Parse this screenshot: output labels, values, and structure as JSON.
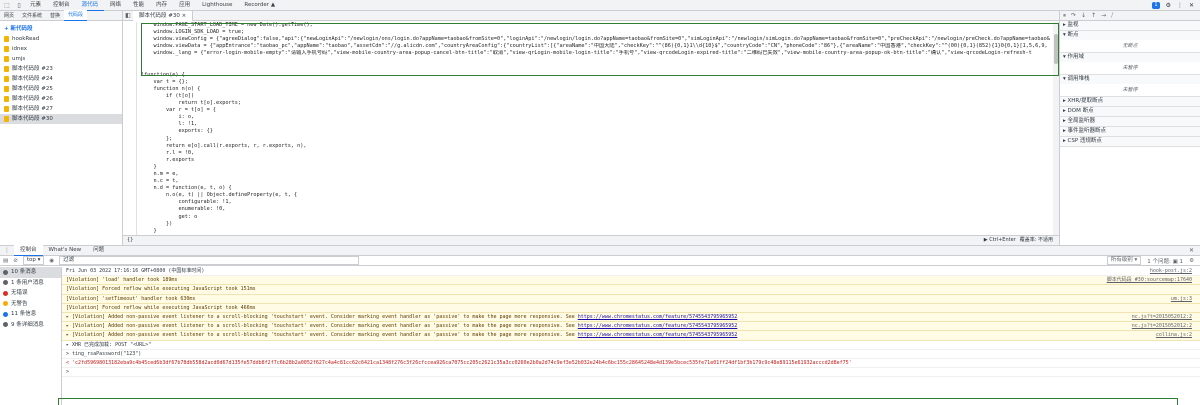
{
  "topbar": {
    "tabs": [
      {
        "label": "元素",
        "active": false
      },
      {
        "label": "控制台",
        "active": false
      },
      {
        "label": "源代码",
        "active": true
      },
      {
        "label": "网络",
        "active": false
      },
      {
        "label": "性能",
        "active": false
      },
      {
        "label": "内存",
        "active": false
      },
      {
        "label": "应用",
        "active": false
      },
      {
        "label": "Lighthouse",
        "active": false
      },
      {
        "label": "Recorder ▲",
        "active": false
      }
    ],
    "badge": "1"
  },
  "nav": {
    "tabs": [
      {
        "label": "网页",
        "active": false
      },
      {
        "label": "文件系统",
        "active": false
      },
      {
        "label": "替换",
        "active": false
      },
      {
        "label": "代码段",
        "active": true
      }
    ],
    "new_snippet": "+ 新代码段",
    "items": [
      {
        "label": "hookRead",
        "selected": false
      },
      {
        "label": "idnex",
        "selected": false
      },
      {
        "label": "umjs",
        "selected": false
      },
      {
        "label": "脚本代码段 #23",
        "selected": false
      },
      {
        "label": "脚本代码段 #24",
        "selected": false
      },
      {
        "label": "脚本代码段 #25",
        "selected": false
      },
      {
        "label": "脚本代码段 #26",
        "selected": false
      },
      {
        "label": "脚本代码段 #27",
        "selected": false
      },
      {
        "label": "脚本代码段 #30",
        "selected": true
      }
    ]
  },
  "editor": {
    "tab_label": "脚本代码段 #30 ×",
    "code_lines": [
      "    window.PAGE_START_LOAD_TIME = new Date().getTime();",
      "    window.LOGIN_SDK_LOAD = true;",
      "    window.viewConfig = {\"agreeDialog\":false,\"api\":{\"newLoginApi\":\"/newlogin/ons/login.do?appName=taobao&fromSite=0\",\"loginApi\":\"/newlogin/login.do?appName=taobao&fromSite=0\",\"simLoginApi\":\"/newlogin/simLogin.do?appName=taobao&fromSite=0\",\"preCheckApi\":\"/newlogin/preCheck.do?appName=taobao&",
      "    window.viewData = {\"appEntrance\":\"taobao_pc\",\"appName\":\"taobao\",\"assetCdn\":\"//g.alicdn.com\",\"countryAreaConfig\":{\"countryList\":[{\"areaName\":\"中国大陆\",\"checkKey\":\"^(86){0,1}1\\\\d{10}$\",\"countryCode\":\"CN\",\"phoneCode\":\"86\"},{\"areaName\":\"中国香港\",\"checkKey\":\"^(00){0,1}(852){1}0{0,1}[1,5,6,9,",
      "    window._lang = {\"error-login-mobile-empty\":\"请输入手机号码\",\"view-mobile-country-area-popup-cancel-btn-title\":\"取消\",\"view-qrLogin-mobile-login-title\":\"手机号\",\"view-qrcodeLogin-expired-title\":\"二维码已失效\",\"view-mobile-country-area-popup-ok-btn-title\":\"确认\",\"view-qrcodeLogin-refresh-t",
      "",
      "",
      "!function(e) {",
      "    var t = {};",
      "    function n(o) {",
      "        if (t[o])",
      "            return t[o].exports;",
      "        var r = t[o] = {",
      "            i: o,",
      "            l: !1,",
      "            exports: {}",
      "        };",
      "        return e[o].call(r.exports, r, r.exports, n),",
      "        r.l = !0,",
      "        r.exports",
      "    }",
      "    n.m = e,",
      "    n.c = t,",
      "    n.d = function(e, t, o) {",
      "        n.o(e, t) || Object.defineProperty(e, t, {",
      "            configurable: !1,",
      "            enumerable: !0,",
      "            get: o",
      "        })",
      "    }",
      "    ,"
    ],
    "status_left": "{}",
    "status_right": [
      "▶ Ctrl+Enter",
      "覆盖率: 不适用"
    ]
  },
  "debugger": {
    "sections": [
      {
        "header": "▸ 监视",
        "body": ""
      },
      {
        "header": "▾ 断点",
        "body": "无断点"
      },
      {
        "header": "▾ 作用域",
        "body": "未暂停"
      },
      {
        "header": "▾ 调用堆栈",
        "body": "未暂停"
      },
      {
        "header": "▸ XHR/提取断点",
        "body": ""
      },
      {
        "header": "▸ DOM 断点",
        "body": ""
      },
      {
        "header": "▸ 全局监听器",
        "body": ""
      },
      {
        "header": "▸ 事件监听器断点",
        "body": ""
      },
      {
        "header": "▸ CSP 违规断点",
        "body": ""
      }
    ]
  },
  "drawer": {
    "tabs": [
      {
        "label": "控制台",
        "active": true
      },
      {
        "label": "What's New",
        "active": false
      },
      {
        "label": "问题",
        "active": false
      }
    ],
    "context": "top ▾",
    "filter_value": "过滤",
    "levels": "所有级别 ▾",
    "issues": "1 个问题: ▣ 1",
    "sidebar": [
      {
        "label": "10 条消息",
        "selected": true,
        "color": "#5f6368"
      },
      {
        "label": "1 条用户消息",
        "selected": false,
        "color": "#5f6368"
      },
      {
        "label": "无错误",
        "selected": false,
        "color": "#d93025"
      },
      {
        "label": "无警告",
        "selected": false,
        "color": "#f9ab00"
      },
      {
        "label": "11 条信息",
        "selected": false,
        "color": "#1a73e8"
      },
      {
        "label": "9 条详细消息",
        "selected": false,
        "color": "#5f6368"
      }
    ],
    "messages": [
      {
        "kind": "plain",
        "text": "Fri Jun 03 2022 17:16:16 GMT+0800 (中国标准时间)",
        "link": "",
        "src": "hook-post.js:2"
      },
      {
        "kind": "warn",
        "text": "[Violation] 'load' handler took 189ms",
        "link": "",
        "src": "脚本代码段 #30:sourcemap:17640"
      },
      {
        "kind": "warn",
        "text": "[Violation] Forced reflow while executing JavaScript took 151ms",
        "link": "",
        "src": ""
      },
      {
        "kind": "warn",
        "text": "[Violation] 'setTimeout' handler took 630ms",
        "link": "",
        "src": "um.js:3"
      },
      {
        "kind": "warn",
        "text": "[Violation] Forced reflow while executing JavaScript took 466ms",
        "link": "",
        "src": ""
      },
      {
        "kind": "warn",
        "text": "▸ [Violation] Added non-passive event listener to a scroll-blocking 'touchstart' event. Consider marking event handler as 'passive' to make the page more responsive. See ",
        "link": "https://www.chromestatus.com/feature/5745543795965952",
        "src": "nc.js?t=2015052012:2"
      },
      {
        "kind": "warn",
        "text": "▸ [Violation] Added non-passive event listener to a scroll-blocking 'touchstart' event. Consider marking event handler as 'passive' to make the page more responsive. See ",
        "link": "https://www.chromestatus.com/feature/5745543795965952",
        "src": "nc.js?t=2015052012:2"
      },
      {
        "kind": "warn",
        "text": "▸ [Violation] Added non-passive event listener to a scroll-blocking 'touchstart' event. Consider marking event handler as 'passive' to make the page more responsive. See ",
        "link": "https://www.chromestatus.com/feature/5745543795965952",
        "src": "collina.js:2"
      },
      {
        "kind": "plain",
        "text": "▸ XHR 已完成加载: POST \"<URL>\"",
        "link": "",
        "src": ""
      },
      {
        "kind": "plain",
        "text": "> ting_rsaPassword(\"123\")",
        "link": "",
        "src": ""
      },
      {
        "kind": "hash",
        "text": "< 'c2fd59698013182eba9c4b45ced6b3df67b78db558d2acd0d67d135fe57ddb8f2f7c6b28b2a0052f627c4a4c81cc62c6421ca1348f276c3f26cfccea926ca7075cc205c2621c35a3cc0260e2b0a2d74c9ef3e52b032e24b4c6bc155c28645248e4d139e5bcec535fe71e01ff24df1bf3b179c9c48e89115e61932acccd2d8ef75'",
        "link": "",
        "src": ""
      },
      {
        "kind": "plain",
        "text": ">",
        "link": "",
        "src": ""
      }
    ]
  }
}
